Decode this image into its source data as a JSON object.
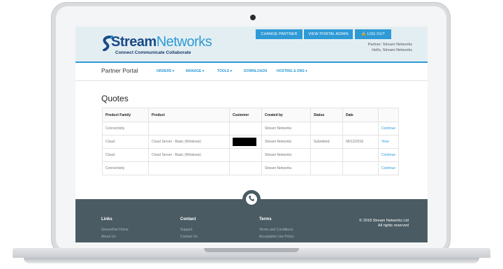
{
  "header": {
    "buttons": [
      "CHANGE PARTNER",
      "VIEW PORTAL ADMIN",
      "LOG OUT"
    ],
    "logo": {
      "brand_a": "Stream",
      "brand_b": "Networks",
      "tagline": "Connect Communicate Collaborate"
    },
    "partner_line": "Partner: Stream Networks",
    "hello_line": "Hello, Stream Networks"
  },
  "nav": {
    "brand": "Partner Portal",
    "items": [
      "ORDERS ▾",
      "MANAGE ▾",
      "TOOLS ▾",
      "DOWNLOADS",
      "HOSTING & DNS ▾"
    ]
  },
  "page": {
    "title": "Quotes"
  },
  "table": {
    "headers": [
      "Product Family",
      "Product",
      "Customer",
      "Created by",
      "Status",
      "Date",
      ""
    ],
    "rows": [
      {
        "family": "Connectivity",
        "product": "",
        "created_by": "Stream Networks",
        "status": "",
        "date": "",
        "action": "Continue",
        "redacted": false
      },
      {
        "family": "Cloud",
        "product": "Cloud Server - Basic (Windows)",
        "created_by": "Stream Networks",
        "status": "Submitted",
        "date": "06/12/2018",
        "action": "View",
        "redacted": true
      },
      {
        "family": "Cloud",
        "product": "Cloud Server - Basic (Windows)",
        "created_by": "Stream Networks",
        "status": "",
        "date": "",
        "action": "Continue",
        "redacted": false
      },
      {
        "family": "Connectivity",
        "product": "",
        "created_by": "Stream Networks",
        "status": "",
        "date": "",
        "action": "Continue",
        "redacted": false
      }
    ]
  },
  "footer": {
    "links_heading": "Links",
    "links": [
      "StreamNet Home",
      "About Us"
    ],
    "contact_heading": "Contact",
    "contact": [
      "Support",
      "Contact Us"
    ],
    "terms_heading": "Terms",
    "terms": [
      "Terms and Conditions",
      "Acceptable Use Policy"
    ],
    "copyright": "© 2018 Stream Networks Ltd",
    "rights": "All rights reserved"
  },
  "colors": {
    "accent": "#2f9ad6",
    "footer": "#4a5b63",
    "header_bg": "#e3eef2"
  }
}
